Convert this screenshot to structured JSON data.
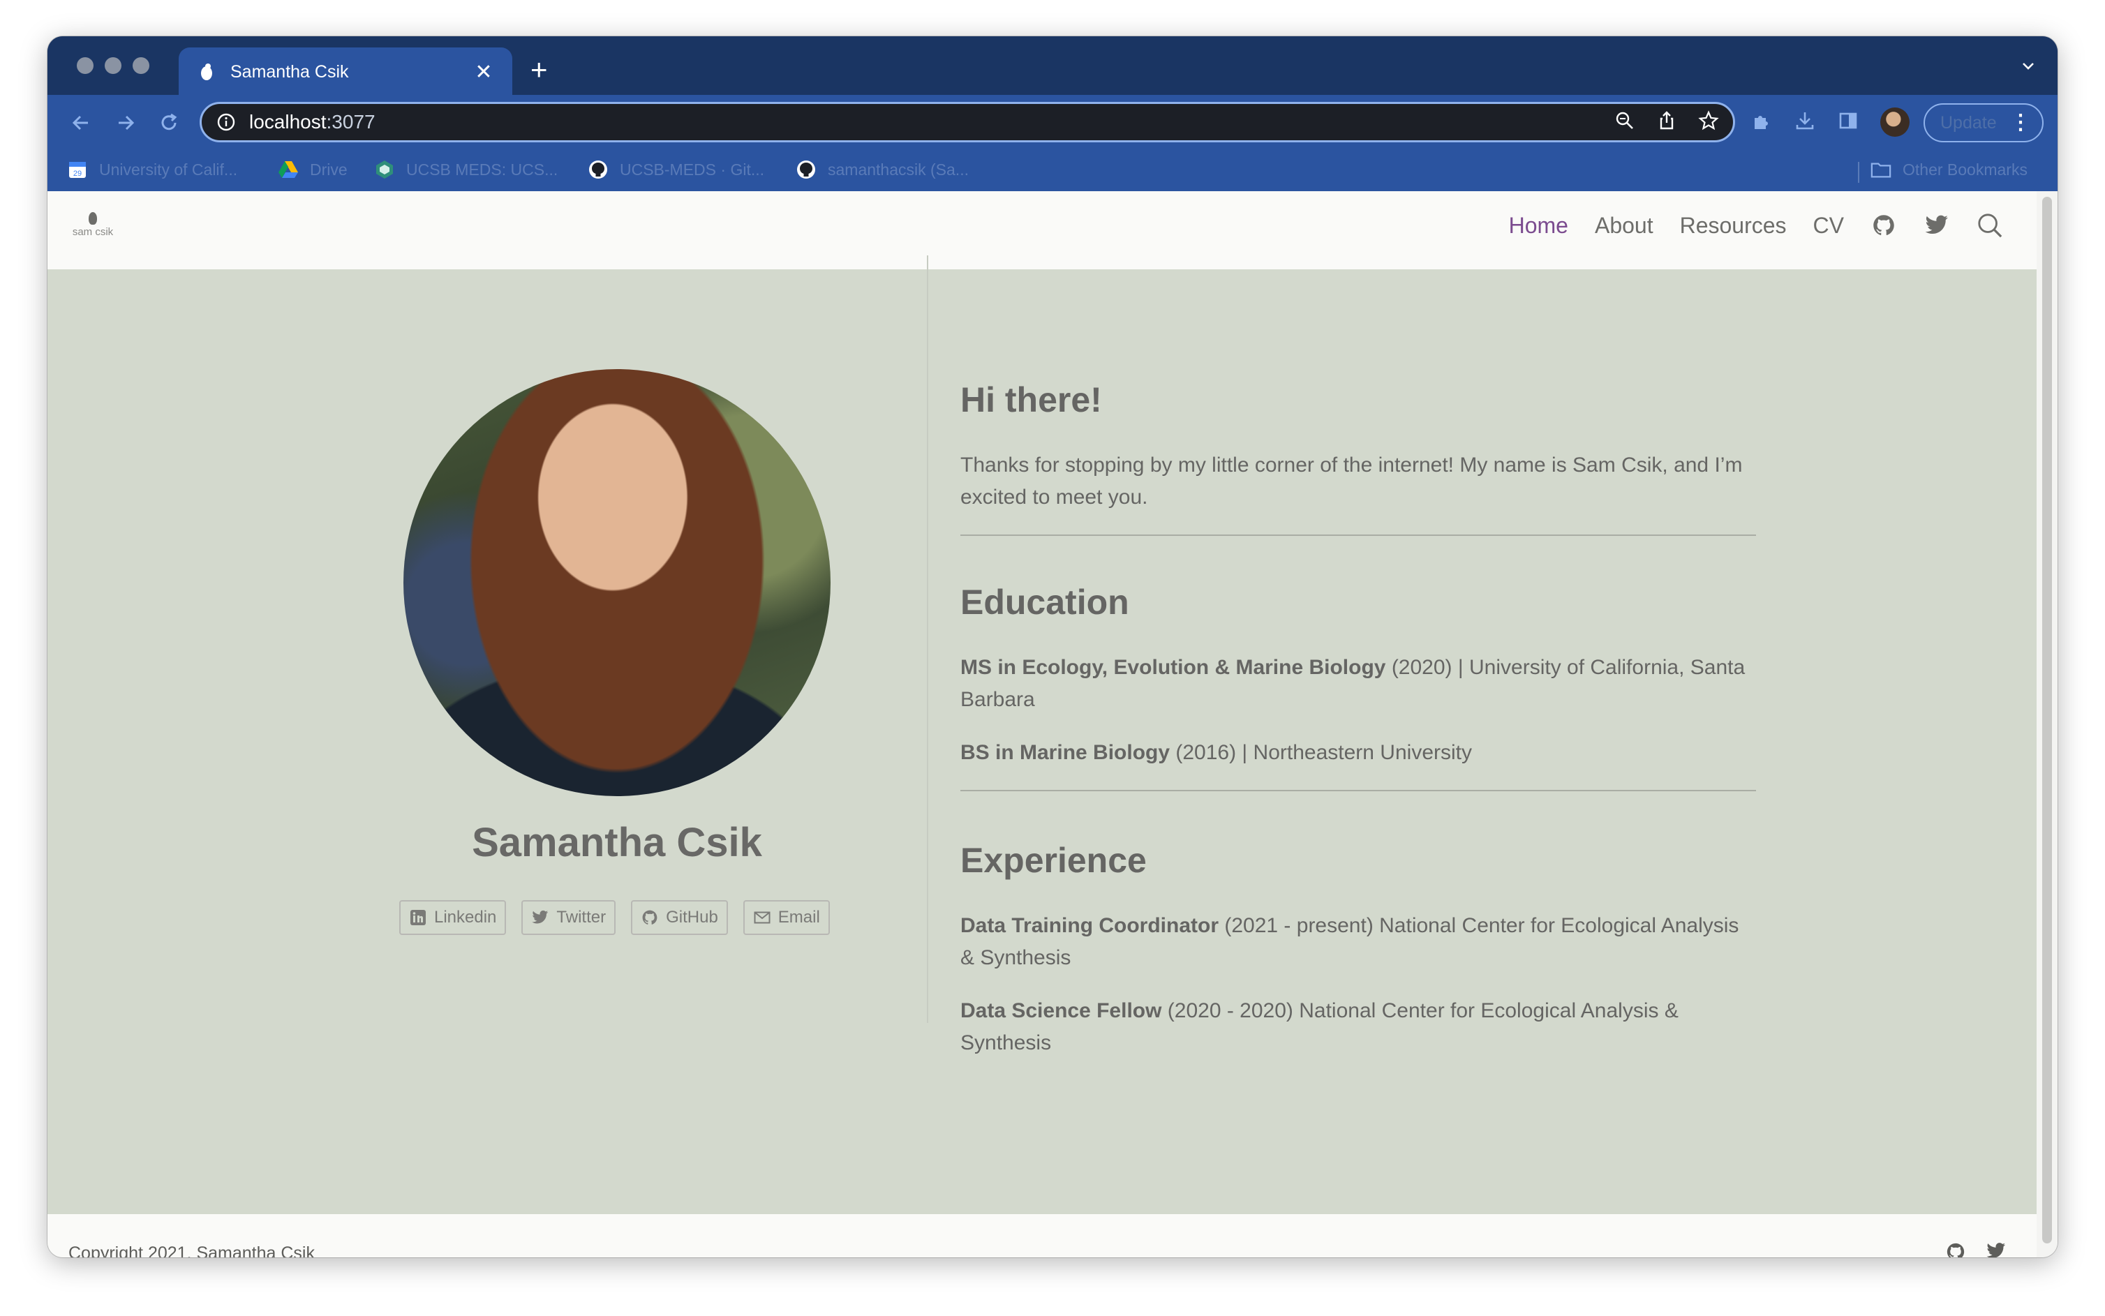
{
  "browser": {
    "tab_title": "Samantha Csik",
    "url_host": "localhost",
    "url_port": ":3077",
    "update_label": "Update",
    "bookmarks": [
      {
        "label": "University of Calif...",
        "icon": "calendar-icon"
      },
      {
        "label": "Drive",
        "icon": "drive-icon"
      },
      {
        "label": "UCSB MEDS: UCS...",
        "icon": "meds-icon"
      },
      {
        "label": "UCSB-MEDS · Git...",
        "icon": "github-icon"
      },
      {
        "label": "samanthacsik (Sa...",
        "icon": "github-icon"
      }
    ],
    "other_bookmarks": "Other Bookmarks"
  },
  "site": {
    "logo_text": "sam csik",
    "nav": [
      {
        "label": "Home",
        "active": true
      },
      {
        "label": "About"
      },
      {
        "label": "Resources"
      },
      {
        "label": "CV"
      }
    ],
    "nav_icons": [
      "github-icon",
      "twitter-icon",
      "search-icon"
    ]
  },
  "profile": {
    "name": "Samantha Csik",
    "links": [
      {
        "label": "Linkedin",
        "icon": "linkedin-icon"
      },
      {
        "label": "Twitter",
        "icon": "twitter-icon"
      },
      {
        "label": "GitHub",
        "icon": "github-icon"
      },
      {
        "label": "Email",
        "icon": "email-icon"
      }
    ]
  },
  "intro": {
    "heading": "Hi there!",
    "text": "Thanks for stopping by my little corner of the internet! My name is Sam Csik, and I’m excited to meet you."
  },
  "education": {
    "heading": "Education",
    "items": [
      {
        "title": "MS in Ecology, Evolution & Marine Biology",
        "rest": " (2020) | University of California, Santa Barbara"
      },
      {
        "title": "BS in Marine Biology",
        "rest": " (2016) | Northeastern University"
      }
    ]
  },
  "experience": {
    "heading": "Experience",
    "items": [
      {
        "title": "Data Training Coordinator",
        "rest": " (2021 - present) National Center for Ecological Analysis & Synthesis"
      },
      {
        "title": "Data Science Fellow",
        "rest": " (2020 - 2020) National Center for Ecological Analysis & Synthesis"
      }
    ]
  },
  "footer": {
    "copyright": "Copyright 2021, Samantha Csik",
    "icons": [
      "github-icon",
      "twitter-icon"
    ]
  },
  "colors": {
    "chrome_dark": "#1a3563",
    "chrome_toolbar": "#2b54a0",
    "page_bg": "#d3d9cd",
    "nav_active": "#7b4b8f",
    "text": "#656563"
  }
}
